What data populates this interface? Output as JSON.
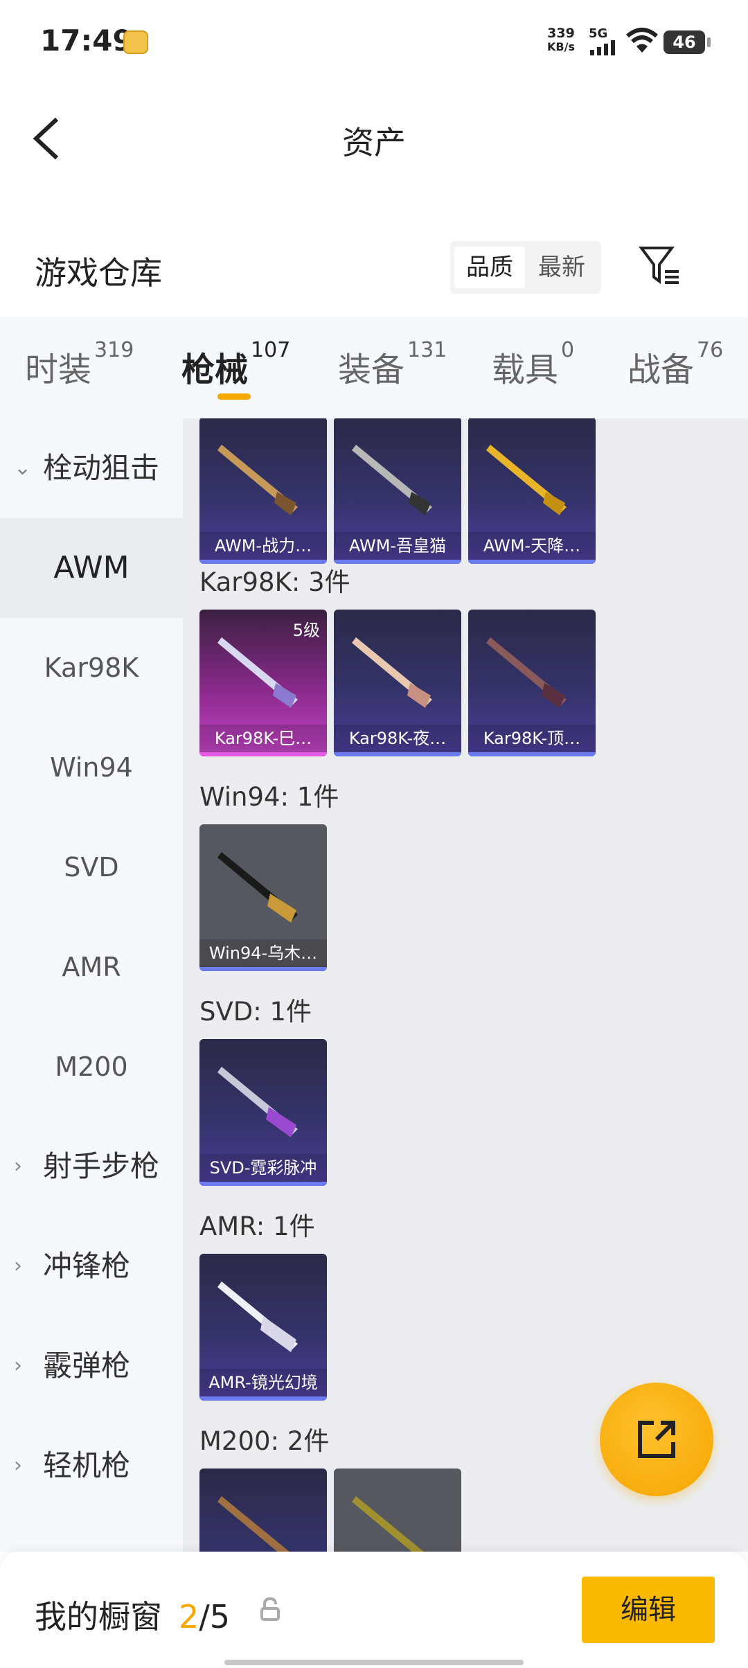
{
  "status": {
    "time": "17:49",
    "speed_value": "339",
    "speed_unit": "KB/s",
    "network": "5G",
    "battery": "46"
  },
  "nav": {
    "title": "资产"
  },
  "warehouse": {
    "title": "游戏仓库",
    "sort_options": [
      "品质",
      "最新"
    ],
    "active_sort": "品质"
  },
  "tabs": [
    {
      "label": "时装",
      "count": "319"
    },
    {
      "label": "枪械",
      "count": "107",
      "active": true
    },
    {
      "label": "装备",
      "count": "131"
    },
    {
      "label": "载具",
      "count": "0"
    },
    {
      "label": "战备",
      "count": "76"
    }
  ],
  "sidebar": {
    "category_open": "栓动狙击",
    "subitems": [
      "AWM",
      "Kar98K",
      "Win94",
      "SVD",
      "AMR",
      "M200"
    ],
    "selected": "AWM",
    "categories": [
      "射手步枪",
      "冲锋枪",
      "霰弹枪",
      "轻机枪"
    ]
  },
  "groups": {
    "awm": {
      "items": [
        "AWM-战力…",
        "AWM-吾皇猫",
        "AWM-天降…"
      ]
    },
    "kar98k": {
      "title": "Kar98K: 3件",
      "items": [
        "Kar98K-巳…",
        "Kar98K-夜…",
        "Kar98K-顶…"
      ],
      "level": "5级"
    },
    "win94": {
      "title": "Win94: 1件",
      "items": [
        "Win94-乌木…"
      ]
    },
    "svd": {
      "title": "SVD: 1件",
      "items": [
        "SVD-霓彩脉冲"
      ]
    },
    "amr": {
      "title": "AMR: 1件",
      "items": [
        "AMR-镜光幻境"
      ]
    },
    "m200": {
      "title": "M200: 2件"
    }
  },
  "bottom": {
    "title": "我的橱窗",
    "current": "2",
    "separator": "/",
    "total": "5",
    "edit_label": "编辑"
  },
  "colors": {
    "accent": "#f5a800",
    "edit_button": "#fbb900"
  }
}
